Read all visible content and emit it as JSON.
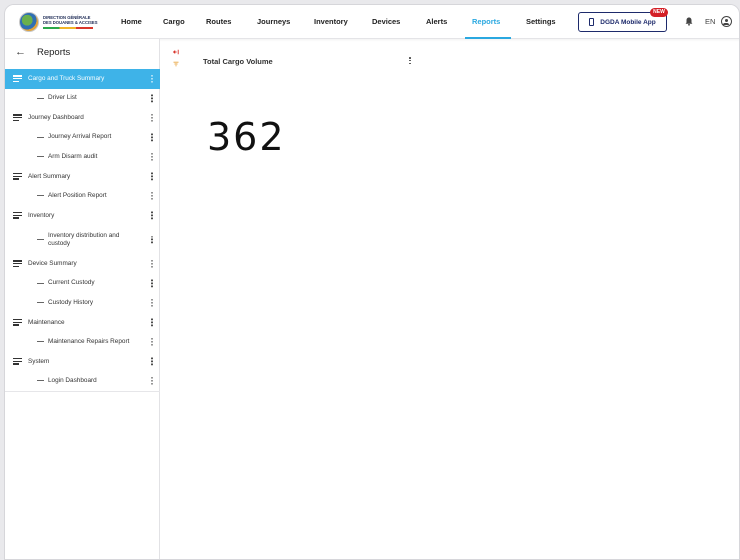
{
  "header": {
    "logo": {
      "line1": "DIRECTION GÉNÉRALE",
      "line2": "DES DOUANES & ACCISES"
    },
    "nav": [
      {
        "label": "Home",
        "active": false
      },
      {
        "label": "Cargo",
        "active": false
      },
      {
        "label": "Routes",
        "active": false
      },
      {
        "label": "Journeys",
        "active": false
      },
      {
        "label": "Inventory",
        "active": false
      },
      {
        "label": "Devices",
        "active": false
      },
      {
        "label": "Alerts",
        "active": false
      },
      {
        "label": "Reports",
        "active": true
      },
      {
        "label": "Settings",
        "active": false
      }
    ],
    "app_button": {
      "label": "DGDA Mobile App",
      "badge": "NEW",
      "icon": "phone-icon"
    },
    "notification_icon": "bell-icon",
    "language": "EN",
    "profile_icon": "user-circle-icon",
    "accent_color": "#2aa8e0"
  },
  "sidebar": {
    "back_icon": "arrow-left-icon",
    "title": "Reports",
    "selected_color": "#3eb3e8",
    "items": [
      {
        "label": "Cargo and Truck Summary",
        "level": 0,
        "selected": true
      },
      {
        "label": "Driver List",
        "level": 1
      },
      {
        "label": "Journey Dashboard",
        "level": 0
      },
      {
        "label": "Journey Arrival Report",
        "level": 1
      },
      {
        "label": "Arm Disarm audit",
        "level": 1
      },
      {
        "label": "Alert Summary",
        "level": 0
      },
      {
        "label": "Alert Position Report",
        "level": 1
      },
      {
        "label": "Inventory",
        "level": 0
      },
      {
        "label": "Inventory distribution and custody",
        "level": 1
      },
      {
        "label": "Device Summary",
        "level": 0
      },
      {
        "label": "Current Custody",
        "level": 1
      },
      {
        "label": "Custody History",
        "level": 1
      },
      {
        "label": "Maintenance",
        "level": 0
      },
      {
        "label": "Maintenance Repairs Report",
        "level": 1
      },
      {
        "label": "System",
        "level": 0
      },
      {
        "label": "Login Dashboard",
        "level": 1
      }
    ]
  },
  "main": {
    "collapse_icon": "collapse-sidebar-icon",
    "filter_icon": "filter-icon",
    "widget": {
      "title": "Total Cargo Volume",
      "value": "362"
    }
  }
}
